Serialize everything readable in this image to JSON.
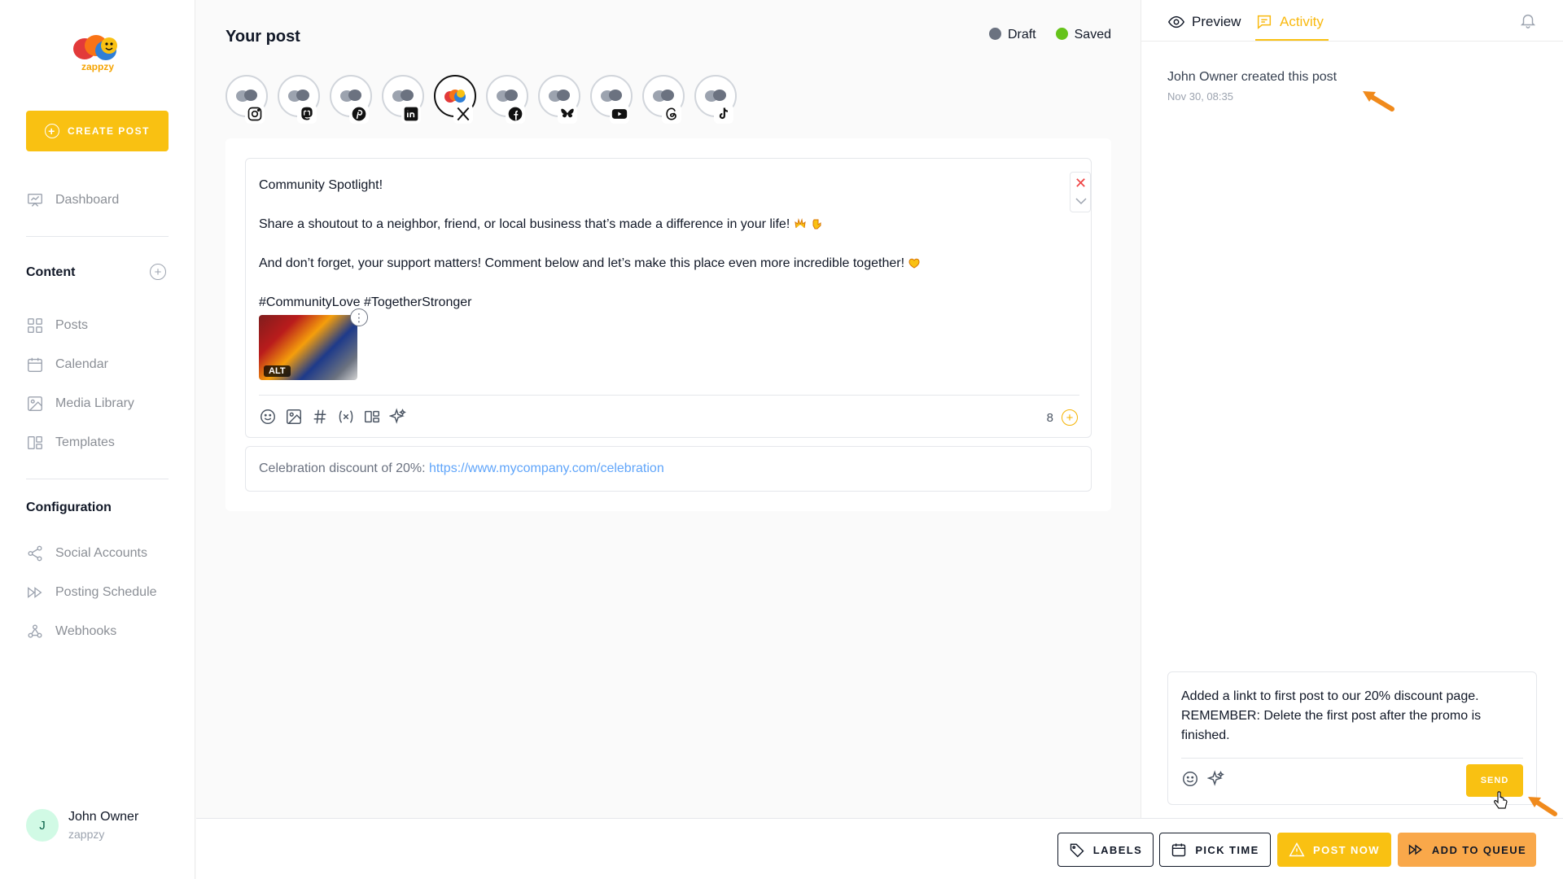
{
  "brand": {
    "name": "zappzy",
    "accent": "#f9c112",
    "logo_text": "zappzy"
  },
  "sidebar": {
    "create_label": "CREATE POST",
    "dashboard": "Dashboard",
    "content_title": "Content",
    "content_items": [
      "Posts",
      "Calendar",
      "Media Library",
      "Templates"
    ],
    "config_title": "Configuration",
    "config_items": [
      "Social Accounts",
      "Posting Schedule",
      "Webhooks"
    ],
    "user": {
      "initial": "J",
      "name": "John Owner",
      "org": "zappzy"
    }
  },
  "main": {
    "title": "Your post",
    "status": {
      "draft": "Draft",
      "saved": "Saved",
      "draft_color": "#6b7280",
      "saved_color": "#65c31a"
    },
    "accounts": [
      {
        "network": "instagram-icon"
      },
      {
        "network": "mastodon-icon"
      },
      {
        "network": "pinterest-icon"
      },
      {
        "network": "linkedin-icon"
      },
      {
        "network": "x-icon",
        "active": true
      },
      {
        "network": "facebook-icon"
      },
      {
        "network": "bluesky-icon"
      },
      {
        "network": "youtube-icon"
      },
      {
        "network": "threads-icon"
      },
      {
        "network": "tiktok-icon"
      }
    ],
    "post": {
      "line1": "Community Spotlight!",
      "line2": "Share a shoutout to a neighbor, friend, or local business that’s made a difference in your life!",
      "line3": "And don’t forget, your support matters! Comment below and let’s make this place even more incredible together!",
      "hashtags": "#CommunityLove #TogetherStronger",
      "alt_label": "ALT",
      "char_count": "8"
    },
    "second_post": {
      "text": "Celebration discount of 20%: ",
      "link": "https://www.mycompany.com/celebration"
    }
  },
  "panel": {
    "tab_preview": "Preview",
    "tab_activity": "Activity",
    "activity_text": "John Owner created this post",
    "activity_time": "Nov 30, 08:35",
    "comment": "Added a linkt to first post to our 20% discount page. REMEMBER: Delete the first post after the promo is finished.",
    "send_label": "SEND"
  },
  "actions": {
    "labels": "LABELS",
    "pick_time": "PICK TIME",
    "post_now": "POST NOW",
    "add_to_queue": "ADD TO QUEUE"
  }
}
